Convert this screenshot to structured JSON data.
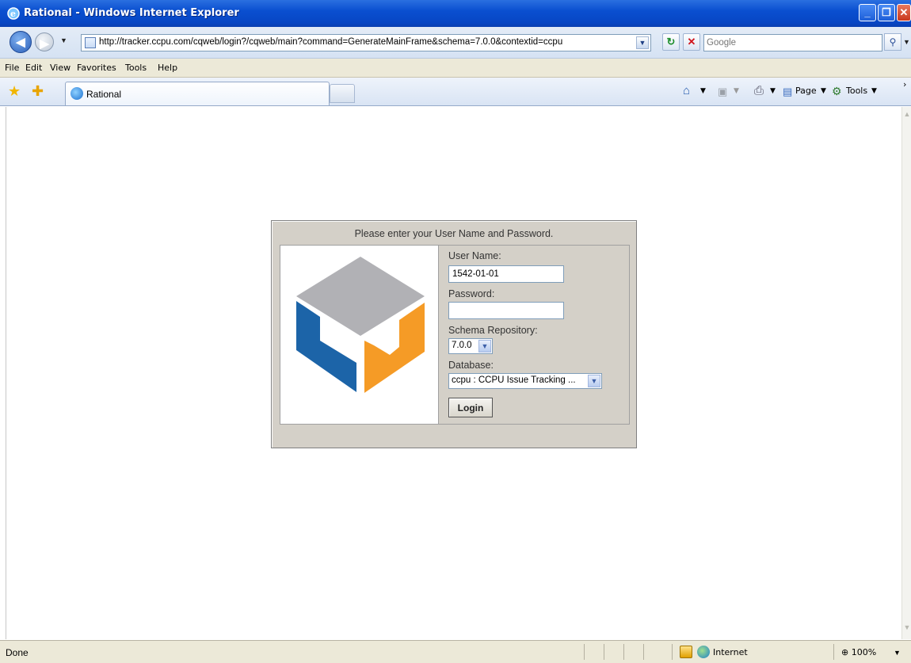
{
  "window": {
    "title": "Rational - Windows Internet Explorer"
  },
  "address_bar": {
    "url": "http://tracker.ccpu.com/cqweb/login?/cqweb/main?command=GenerateMainFrame&schema=7.0.0&contextid=ccpu",
    "search_placeholder": "Google"
  },
  "menu": {
    "items": [
      "File",
      "Edit",
      "View",
      "Favorites",
      "Tools",
      "Help"
    ]
  },
  "tabs": {
    "active_label": "Rational"
  },
  "command_bar": {
    "page_label": "Page",
    "tools_label": "Tools"
  },
  "login": {
    "header": "Please enter your User Name and Password.",
    "username_label": "User Name:",
    "username_value": "1542-01-01",
    "password_label": "Password:",
    "password_value": "",
    "schema_label": "Schema Repository:",
    "schema_value": "7.0.0",
    "database_label": "Database:",
    "database_value": "ccpu : CCPU Issue Tracking ...",
    "login_button": "Login",
    "logo_colors": {
      "top": "#b1b1b5",
      "left": "#1c64a8",
      "right": "#f59b26"
    }
  },
  "status": {
    "text": "Done",
    "zone": "Internet",
    "zoom": "100%"
  }
}
